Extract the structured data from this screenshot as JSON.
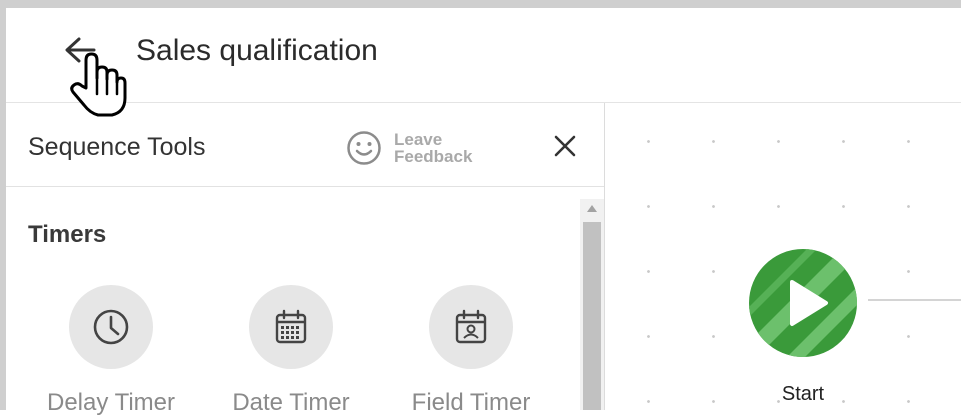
{
  "header": {
    "title": "Sales qualification"
  },
  "panel": {
    "title": "Sequence Tools",
    "feedback": {
      "line1": "Leave",
      "line2": "Feedback"
    },
    "section_title": "Timers",
    "tools": [
      {
        "label": "Delay Timer",
        "icon": "clock-icon"
      },
      {
        "label": "Date Timer",
        "icon": "calendar-icon"
      },
      {
        "label": "Field Timer",
        "icon": "calendar-person-icon"
      }
    ]
  },
  "canvas": {
    "start_label": "Start"
  },
  "colors": {
    "start_green": "#3a9a3a",
    "start_light": "#6cc06c",
    "icon_circle": "#e6e6e6"
  }
}
